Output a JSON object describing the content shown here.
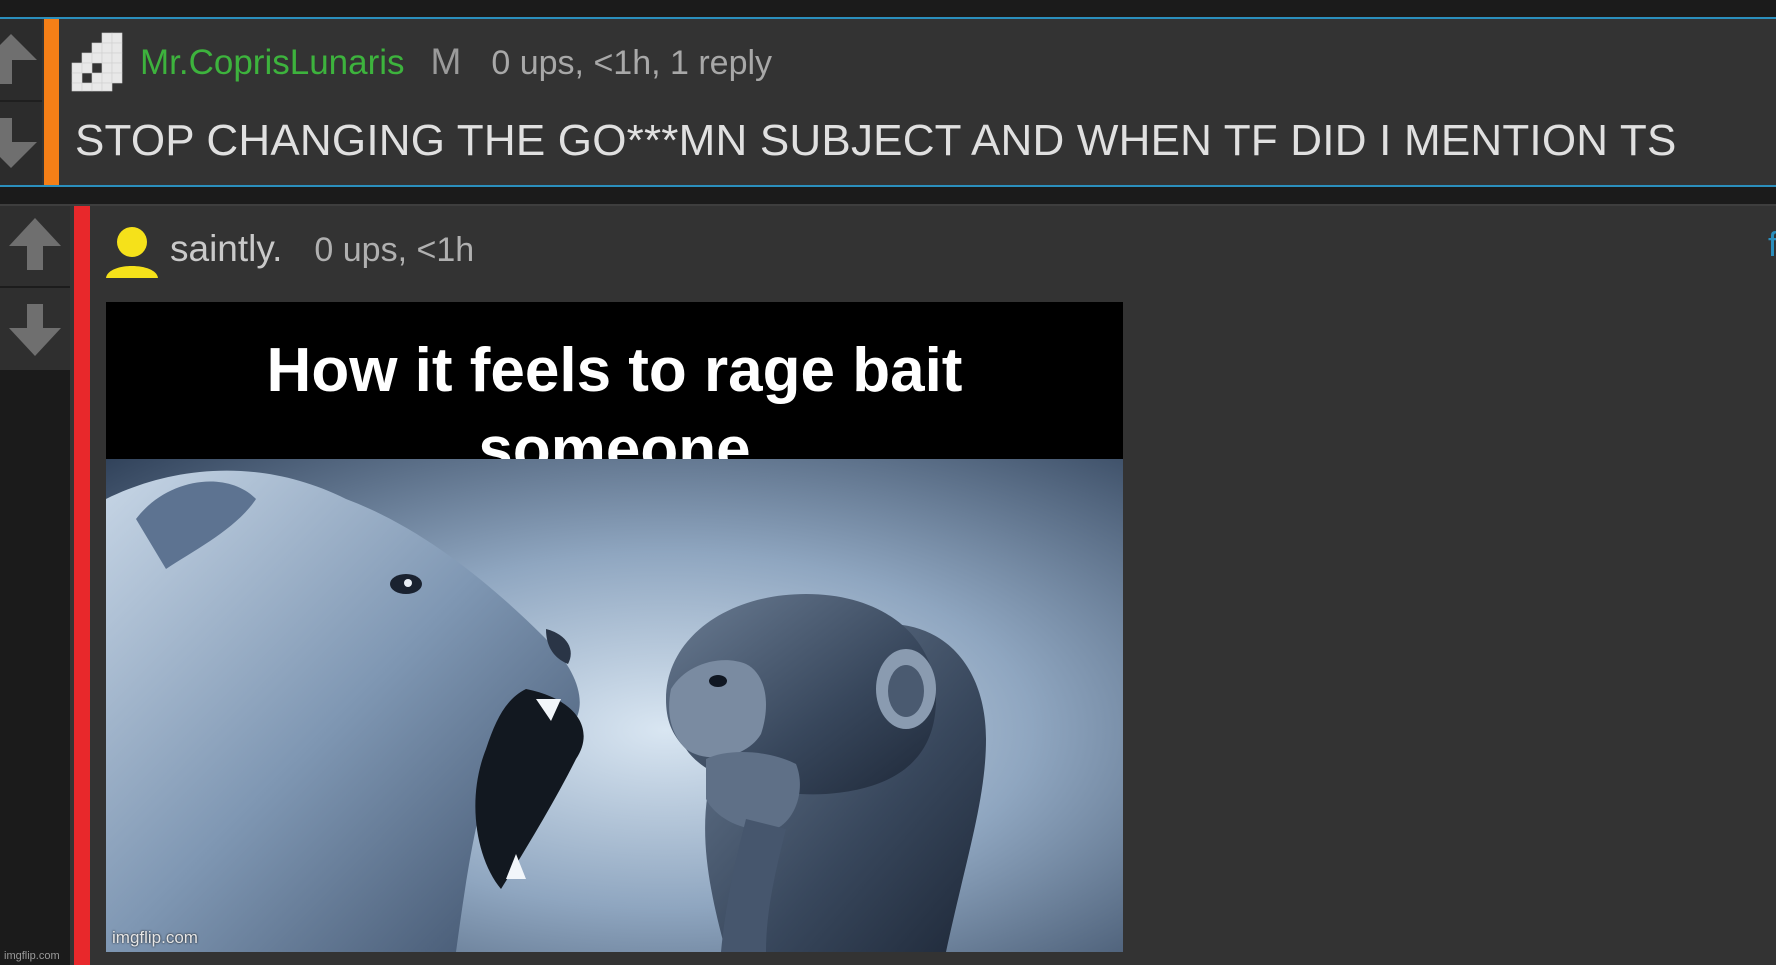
{
  "comment_1": {
    "username": "Mr.CoprisLunaris",
    "badge": "M",
    "meta": "0 ups, <1h, 1 reply",
    "body": "STOP CHANGING THE GO***MN SUBJECT AND WHEN TF DID I MENTION TS",
    "username_color": "#3db33d",
    "stripe_color": "#f57f17"
  },
  "comment_2": {
    "username": "saintly.",
    "meta": "0 ups, <1h",
    "edge_link": "f",
    "stripe_color": "#e8282b",
    "avatar_color": "#f5e11a",
    "image": {
      "caption_line_1": "How it feels to rage bait",
      "caption_line_2": "someone",
      "watermark": "imgflip.com"
    }
  },
  "page_watermark": "imgflip.com",
  "icons": {
    "upvote": "up-arrow-icon",
    "downvote": "down-arrow-icon",
    "avatar_1": "pixel-blocks-avatar-icon",
    "avatar_2": "person-avatar-icon"
  },
  "colors": {
    "background": "#1b1b1b",
    "panel": "#333333",
    "accent_border": "#2b8fbd"
  }
}
